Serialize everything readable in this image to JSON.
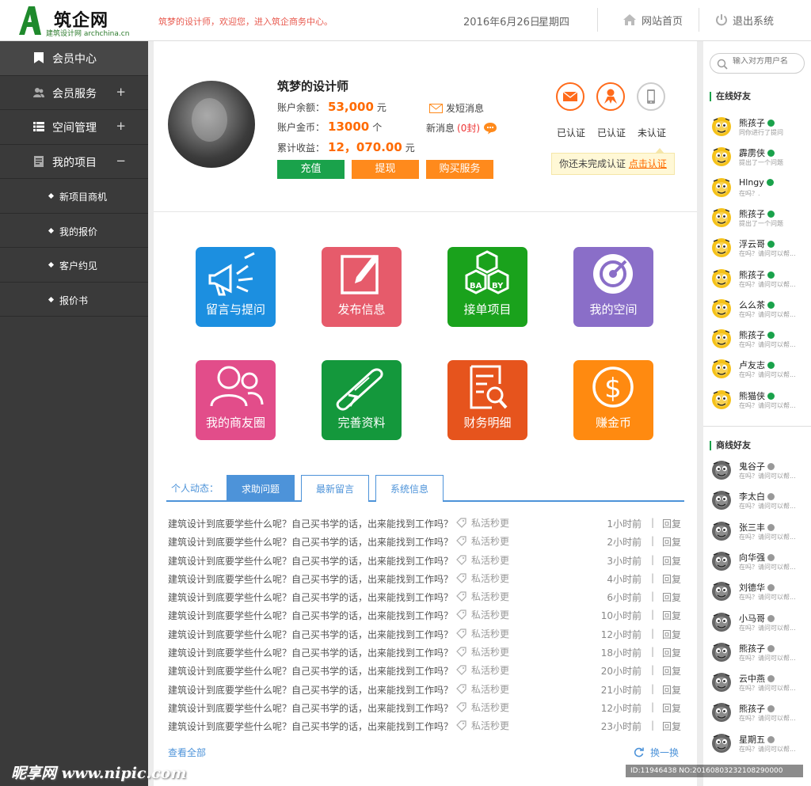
{
  "header": {
    "logo_name": "筑企网",
    "logo_sub": "建筑设计网 archchina.cn",
    "welcome": "筑梦的设计师，欢迎您，进入筑企商务中心。",
    "date": "2016年6月26日",
    "weekday": "星期四",
    "home_link": "网站首页",
    "logout_link": "退出系统"
  },
  "sidebar": {
    "items": [
      {
        "label": "会员中心",
        "toggle": ""
      },
      {
        "label": "会员服务",
        "toggle": "+"
      },
      {
        "label": "空间管理",
        "toggle": "+"
      },
      {
        "label": "我的项目",
        "toggle": "−"
      }
    ],
    "subitems": [
      "新项目商机",
      "我的报价",
      "客户约见",
      "报价书"
    ]
  },
  "profile": {
    "name": "筑梦的设计师",
    "balance_label": "账户余额：",
    "balance": "53,000",
    "balance_unit": "元",
    "coins_label": "账户金币：",
    "coins": "13000",
    "coins_unit": "个",
    "income_label": "累计收益：",
    "income": "12，070.00",
    "income_unit": "元",
    "sms": "发短消息",
    "new_msg_label": "新消息",
    "new_msg_count": "(0封)",
    "btn_recharge": "充值",
    "btn_withdraw": "提现",
    "btn_buy": "购买服务"
  },
  "verify": {
    "email": "已认证",
    "identity": "已认证",
    "phone": "未认证",
    "tip": "你还未完成认证",
    "tip_link": "点击认证",
    "colors": {
      "accent": "#ff6a1a",
      "inactive": "#cccccc"
    }
  },
  "tiles": [
    {
      "label": "留言与提问",
      "icon": "megaphone-icon",
      "color": "#1c8fe0"
    },
    {
      "label": "发布信息",
      "icon": "edit-icon",
      "color": "#e65b6b"
    },
    {
      "label": "接单项目",
      "icon": "blocks-icon",
      "color": "#1aa21c"
    },
    {
      "label": "我的空间",
      "icon": "target-icon",
      "color": "#8a6ec8"
    },
    {
      "label": "我的商友圈",
      "icon": "users-icon",
      "color": "#e24d8a"
    },
    {
      "label": "完善资料",
      "icon": "diploma-icon",
      "color": "#14983c"
    },
    {
      "label": "财务明细",
      "icon": "document-search-icon",
      "color": "#e6541d"
    },
    {
      "label": "赚金币",
      "icon": "dollar-icon",
      "color": "#ff8a10"
    }
  ],
  "activity": {
    "title": "个人动态：",
    "tabs": [
      "求助问题",
      "最新留言",
      "系统信息"
    ],
    "rows": [
      {
        "q": "建筑设计到底要学些什么呢？自己买书学的话，出来能找到工作吗？",
        "tag": "私活秒更",
        "time": "1小时前",
        "reply": "回复"
      },
      {
        "q": "建筑设计到底要学些什么呢？自己买书学的话，出来能找到工作吗？",
        "tag": "私活秒更",
        "time": "2小时前",
        "reply": "回复"
      },
      {
        "q": "建筑设计到底要学些什么呢？自己买书学的话，出来能找到工作吗？",
        "tag": "私活秒更",
        "time": "3小时前",
        "reply": "回复"
      },
      {
        "q": "建筑设计到底要学些什么呢？自己买书学的话，出来能找到工作吗？",
        "tag": "私活秒更",
        "time": "4小时前",
        "reply": "回复"
      },
      {
        "q": "建筑设计到底要学些什么呢？自己买书学的话，出来能找到工作吗？",
        "tag": "私活秒更",
        "time": "6小时前",
        "reply": "回复"
      },
      {
        "q": "建筑设计到底要学些什么呢？自己买书学的话，出来能找到工作吗？",
        "tag": "私活秒更",
        "time": "10小时前",
        "reply": "回复"
      },
      {
        "q": "建筑设计到底要学些什么呢？自己买书学的话，出来能找到工作吗？",
        "tag": "私活秒更",
        "time": "12小时前",
        "reply": "回复"
      },
      {
        "q": "建筑设计到底要学些什么呢？自己买书学的话，出来能找到工作吗？",
        "tag": "私活秒更",
        "time": "18小时前",
        "reply": "回复"
      },
      {
        "q": "建筑设计到底要学些什么呢？自己买书学的话，出来能找到工作吗？",
        "tag": "私活秒更",
        "time": "20小时前",
        "reply": "回复"
      },
      {
        "q": "建筑设计到底要学些什么呢？自己买书学的话，出来能找到工作吗？",
        "tag": "私活秒更",
        "time": "21小时前",
        "reply": "回复"
      },
      {
        "q": "建筑设计到底要学些什么呢？自己买书学的话，出来能找到工作吗？",
        "tag": "私活秒更",
        "time": "12小时前",
        "reply": "回复"
      },
      {
        "q": "建筑设计到底要学些什么呢？自己买书学的话，出来能找到工作吗？",
        "tag": "私活秒更",
        "time": "23小时前",
        "reply": "回复"
      }
    ],
    "view_all": "查看全部",
    "refresh": "换一换"
  },
  "right": {
    "search_placeholder": "输入对方用户名",
    "online_title": "在线好友",
    "online": [
      {
        "name": "熊孩子",
        "msg": "同你进行了提问"
      },
      {
        "name": "霹雳侠",
        "msg": "提出了一个问题"
      },
      {
        "name": "Hlngy",
        "msg": "在吗？."
      },
      {
        "name": "熊孩子",
        "msg": "提出了一个问题"
      },
      {
        "name": "浮云哥",
        "msg": "在吗？请问可以帮..."
      },
      {
        "name": "熊孩子",
        "msg": "在吗？请问可以帮..."
      },
      {
        "name": "么么茶",
        "msg": "在吗？请问可以帮..."
      },
      {
        "name": "熊孩子",
        "msg": "在吗？请问可以帮..."
      },
      {
        "name": "卢友志",
        "msg": "在吗？请问可以帮..."
      },
      {
        "name": "熊猫侠",
        "msg": "在吗？请问可以帮..."
      }
    ],
    "business_title": "商线好友",
    "business": [
      {
        "name": "鬼谷子",
        "msg": "在吗？请问可以帮..."
      },
      {
        "name": "李太白",
        "msg": "在吗？请问可以帮..."
      },
      {
        "name": "张三丰",
        "msg": "在吗？请问可以帮..."
      },
      {
        "name": "向华强",
        "msg": "在吗？请问可以帮..."
      },
      {
        "name": "刘德华",
        "msg": "在吗？请问可以帮..."
      },
      {
        "name": "小马哥",
        "msg": "在吗？请问可以帮..."
      },
      {
        "name": "熊孩子",
        "msg": "在吗？请问可以帮..."
      },
      {
        "name": "云中燕",
        "msg": "在吗？请问可以帮..."
      },
      {
        "name": "熊孩子",
        "msg": "在吗？请问可以帮..."
      },
      {
        "name": "星期五",
        "msg": "在吗？请问可以帮..."
      }
    ]
  },
  "watermark": {
    "site": "昵享网 www.nipic.com",
    "id": "ID:11946438 NO:20160803232108290000"
  }
}
